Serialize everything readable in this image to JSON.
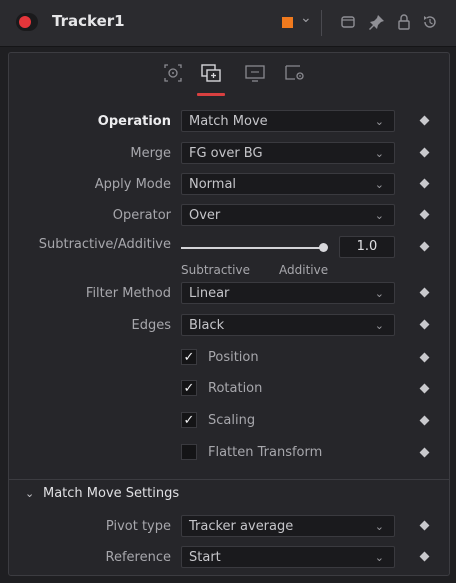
{
  "header": {
    "title": "Tracker1",
    "color_swatch": "#f07a1e",
    "icons": [
      "power-icon",
      "chevron-down-icon",
      "window-icon",
      "pin-icon",
      "lock-icon",
      "reset-icon"
    ]
  },
  "tabs": [
    {
      "name": "target-icon",
      "selected": false
    },
    {
      "name": "operation-icon",
      "selected": true
    },
    {
      "name": "display-icon",
      "selected": false
    },
    {
      "name": "settings-icon",
      "selected": false
    }
  ],
  "fields": {
    "operation": {
      "label": "Operation",
      "value": "Match Move"
    },
    "merge": {
      "label": "Merge",
      "value": "FG over BG"
    },
    "apply_mode": {
      "label": "Apply Mode",
      "value": "Normal"
    },
    "operator": {
      "label": "Operator",
      "value": "Over"
    },
    "subadd": {
      "label": "Subtractive/Additive",
      "value": "1.0",
      "fraction": 1.0,
      "min_label": "Subtractive",
      "max_label": "Additive"
    },
    "filter_method": {
      "label": "Filter Method",
      "value": "Linear"
    },
    "edges": {
      "label": "Edges",
      "value": "Black"
    }
  },
  "checkboxes": [
    {
      "label": "Position",
      "checked": true
    },
    {
      "label": "Rotation",
      "checked": true
    },
    {
      "label": "Scaling",
      "checked": true
    },
    {
      "label": "Flatten Transform",
      "checked": false
    }
  ],
  "section": {
    "title": "Match Move Settings",
    "pivot_type": {
      "label": "Pivot type",
      "value": "Tracker average"
    },
    "reference": {
      "label": "Reference",
      "value": "Start"
    }
  },
  "check_glyph": "✓",
  "chevron_glyph": "⌄"
}
